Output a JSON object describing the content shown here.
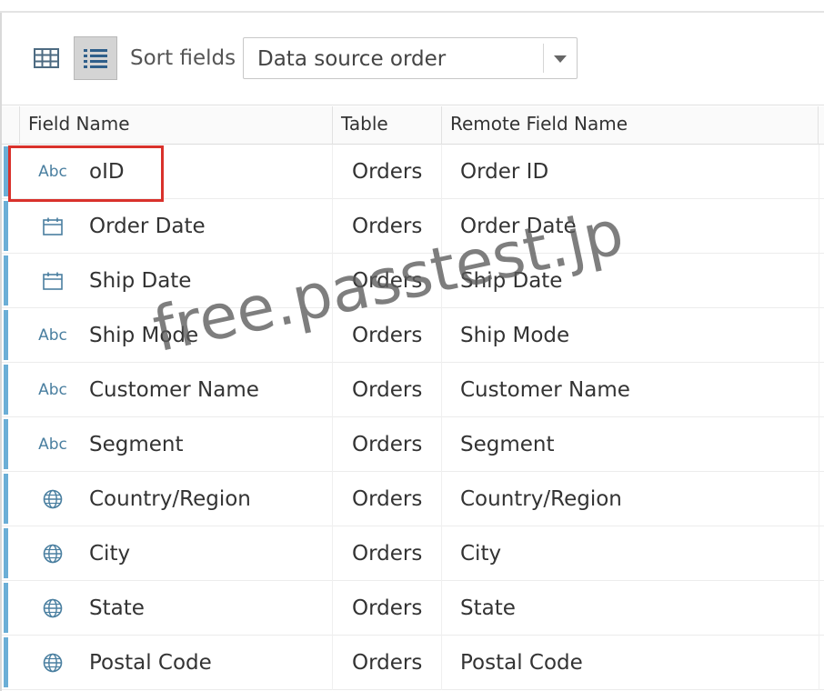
{
  "toolbar": {
    "grid_view_icon": "grid-icon",
    "list_view_icon": "list-icon",
    "sort_label": "Sort fields",
    "sort_value": "Data source order"
  },
  "table": {
    "columns": [
      "Field Name",
      "Table",
      "Remote Field Name"
    ],
    "rows": [
      {
        "icon": "Abc",
        "type": "string",
        "field": "oID",
        "table": "Orders",
        "remote": "Order ID"
      },
      {
        "icon": "calendar-icon",
        "type": "date",
        "field": "Order Date",
        "table": "Orders",
        "remote": "Order Date"
      },
      {
        "icon": "calendar-icon",
        "type": "date",
        "field": "Ship Date",
        "table": "Orders",
        "remote": "Ship Date"
      },
      {
        "icon": "Abc",
        "type": "string",
        "field": "Ship Mode",
        "table": "Orders",
        "remote": "Ship Mode"
      },
      {
        "icon": "Abc",
        "type": "string",
        "field": "Customer Name",
        "table": "Orders",
        "remote": "Customer Name"
      },
      {
        "icon": "Abc",
        "type": "string",
        "field": "Segment",
        "table": "Orders",
        "remote": "Segment"
      },
      {
        "icon": "globe-icon",
        "type": "geo",
        "field": "Country/Region",
        "table": "Orders",
        "remote": "Country/Region"
      },
      {
        "icon": "globe-icon",
        "type": "geo",
        "field": "City",
        "table": "Orders",
        "remote": "City"
      },
      {
        "icon": "globe-icon",
        "type": "geo",
        "field": "State",
        "table": "Orders",
        "remote": "State"
      },
      {
        "icon": "globe-icon",
        "type": "geo",
        "field": "Postal Code",
        "table": "Orders",
        "remote": "Postal Code"
      }
    ]
  },
  "watermark": "free.passtest.jp",
  "colors": {
    "accent_bar": "#6baed6",
    "icon_blue": "#4a7fa0",
    "highlight": "#d9312b"
  }
}
